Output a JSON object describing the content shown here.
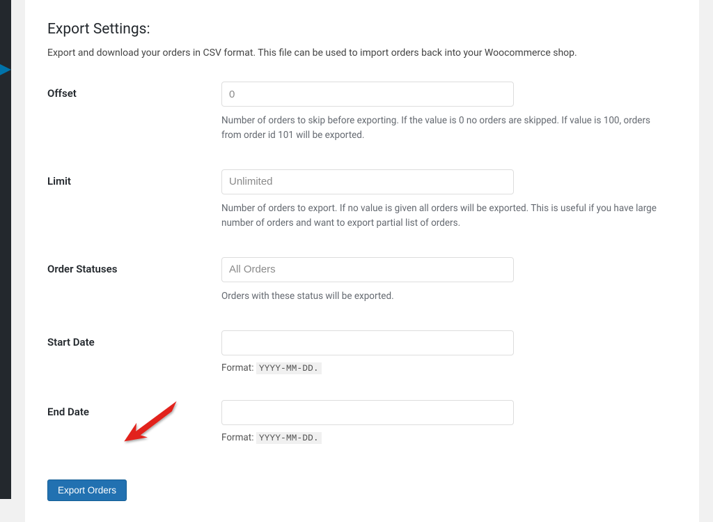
{
  "heading": "Export Settings:",
  "subheading": "Export and download your orders in CSV format. This file can be used to import orders back into your Woocommerce shop.",
  "fields": {
    "offset": {
      "label": "Offset",
      "placeholder": "0",
      "help": "Number of orders to skip before exporting. If the value is 0 no orders are skipped. If value is 100, orders from order id 101 will be exported."
    },
    "limit": {
      "label": "Limit",
      "placeholder": "Unlimited",
      "help": "Number of orders to export. If no value is given all orders will be exported. This is useful if you have large number of orders and want to export partial list of orders."
    },
    "order_statuses": {
      "label": "Order Statuses",
      "placeholder": "All Orders",
      "help": "Orders with these status will be exported."
    },
    "start_date": {
      "label": "Start Date",
      "format_prefix": "Format:  ",
      "format_code": "YYYY-MM-DD."
    },
    "end_date": {
      "label": "End Date",
      "format_prefix": "Format:  ",
      "format_code": "YYYY-MM-DD."
    }
  },
  "button": {
    "export_label": "Export Orders"
  }
}
